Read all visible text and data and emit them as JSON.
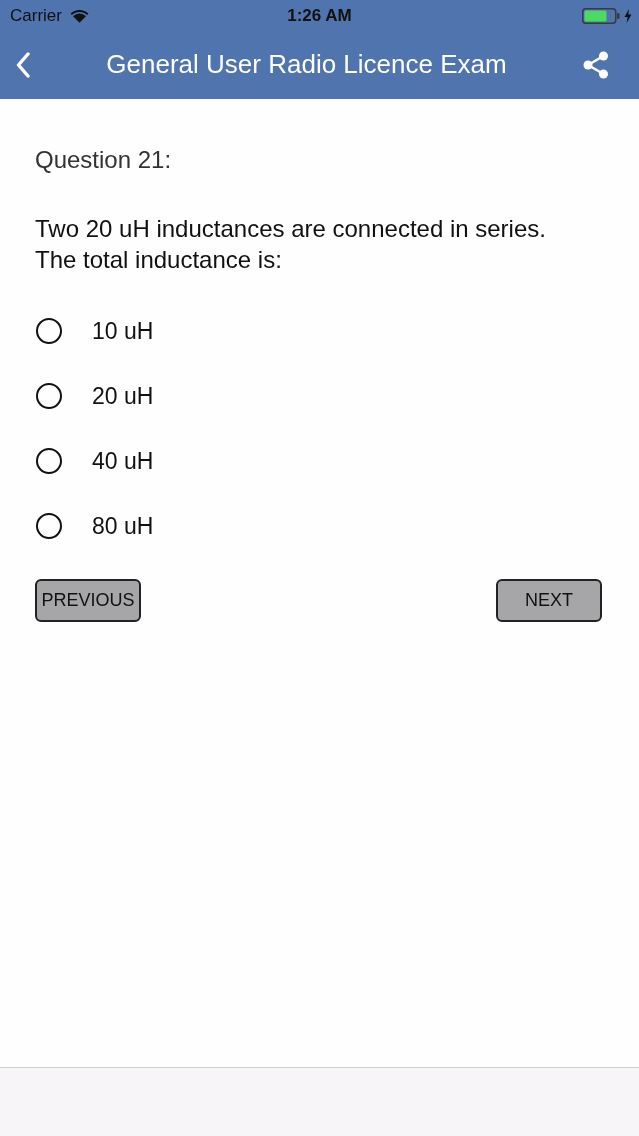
{
  "status_bar": {
    "carrier": "Carrier",
    "time": "1:26 AM"
  },
  "nav_bar": {
    "title": "General User Radio Licence Exam"
  },
  "question": {
    "number": "Question 21:",
    "text": "Two 20 uH inductances are connected in series. The total inductance is:"
  },
  "options": [
    {
      "label": "10 uH",
      "selected": false
    },
    {
      "label": "20 uH",
      "selected": false
    },
    {
      "label": "40 uH",
      "selected": false
    },
    {
      "label": "80 uH",
      "selected": false
    }
  ],
  "buttons": [
    {
      "label": "PREVIOUS"
    },
    {
      "label": "NEXT"
    }
  ]
}
